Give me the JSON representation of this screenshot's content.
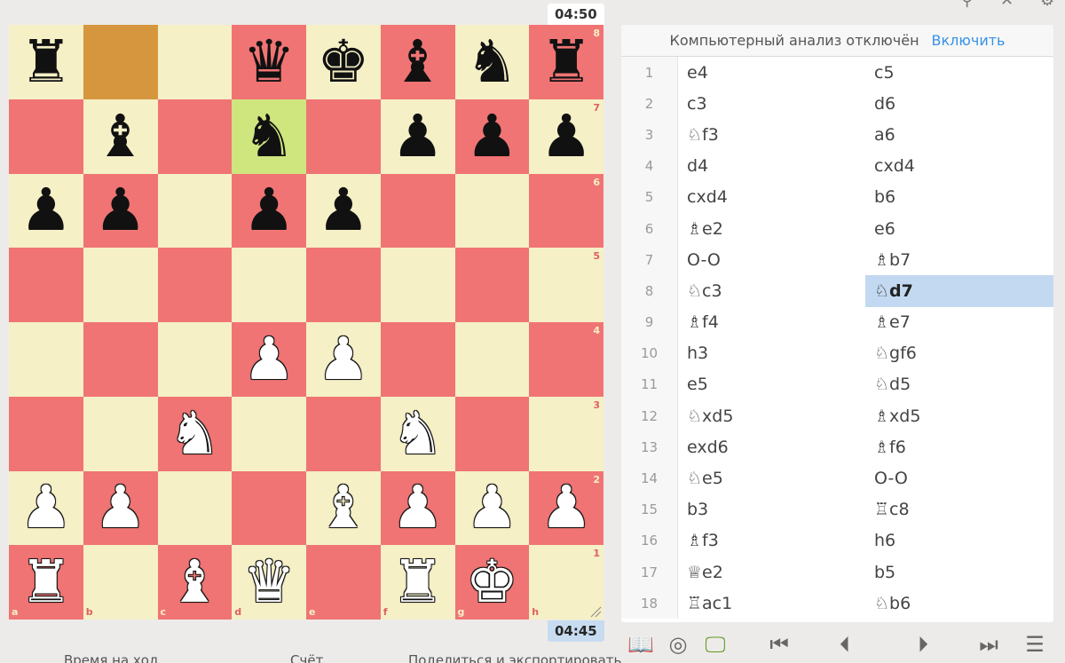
{
  "clocks": {
    "top": "04:50",
    "bottom": "04:45"
  },
  "board": {
    "ranks": [
      "8",
      "7",
      "6",
      "5",
      "4",
      "3",
      "2",
      "1"
    ],
    "files": [
      "a",
      "b",
      "c",
      "d",
      "e",
      "f",
      "g",
      "h"
    ],
    "rows": [
      [
        "br",
        "",
        "",
        "bq",
        "bk",
        "bb",
        "bn",
        "br"
      ],
      [
        "",
        "bb",
        "",
        "bn",
        "",
        "bp",
        "bp",
        "bp"
      ],
      [
        "bp",
        "bp",
        "",
        "bp",
        "bp",
        "",
        "",
        ""
      ],
      [
        "",
        "",
        "",
        "",
        "",
        "",
        "",
        ""
      ],
      [
        "",
        "",
        "",
        "wp",
        "wp",
        "",
        "",
        ""
      ],
      [
        "",
        "",
        "wn",
        "",
        "",
        "wn",
        "",
        ""
      ],
      [
        "wp",
        "wp",
        "",
        "",
        "wb",
        "wp",
        "wp",
        "wp"
      ],
      [
        "wr",
        "",
        "wb",
        "wq",
        "",
        "wr",
        "wk",
        ""
      ]
    ],
    "highlight": {
      "from": "b8",
      "to": "d7"
    }
  },
  "analysis": {
    "disabled_text": "Компьютерный анализ отключён",
    "enable_label": "Включить"
  },
  "moves": [
    {
      "n": "1",
      "w": "e4",
      "b": "c5"
    },
    {
      "n": "2",
      "w": "c3",
      "b": "d6"
    },
    {
      "n": "3",
      "w": "♘f3",
      "b": "a6"
    },
    {
      "n": "4",
      "w": "d4",
      "b": "cxd4"
    },
    {
      "n": "5",
      "w": "cxd4",
      "b": "b6"
    },
    {
      "n": "6",
      "w": "♗e2",
      "b": "e6"
    },
    {
      "n": "7",
      "w": "O-O",
      "b": "♗b7"
    },
    {
      "n": "8",
      "w": "♘c3",
      "b": "♘d7"
    },
    {
      "n": "9",
      "w": "♗f4",
      "b": "♗e7"
    },
    {
      "n": "10",
      "w": "h3",
      "b": "♘gf6"
    },
    {
      "n": "11",
      "w": "e5",
      "b": "♘d5"
    },
    {
      "n": "12",
      "w": "♘xd5",
      "b": "♗xd5"
    },
    {
      "n": "13",
      "w": "exd6",
      "b": "♗f6"
    },
    {
      "n": "14",
      "w": "♘e5",
      "b": "O-O"
    },
    {
      "n": "15",
      "w": "b3",
      "b": "♖c8"
    },
    {
      "n": "16",
      "w": "♗f3",
      "b": "h6"
    },
    {
      "n": "17",
      "w": "♕e2",
      "b": "b5"
    },
    {
      "n": "18",
      "w": "♖ac1",
      "b": "♘b6"
    }
  ],
  "active_move": {
    "index": 7,
    "side": "b"
  },
  "controls": {
    "book_icon": "📖",
    "target_icon": "◎",
    "monitor_icon": "🖵",
    "first_icon": "⏮",
    "prev_icon": "⏴",
    "next_icon": "⏵",
    "last_icon": "⏭",
    "menu_icon": "☰"
  },
  "bottom_tabs": {
    "time": "Время на ход",
    "score": "Счёт",
    "share": "Поделиться и экспортировать"
  },
  "colors": {
    "light_square": "#f5f0c6",
    "dark_square": "#f07474",
    "move_highlight": "#c3d9f1",
    "accent": "#3692e7"
  }
}
